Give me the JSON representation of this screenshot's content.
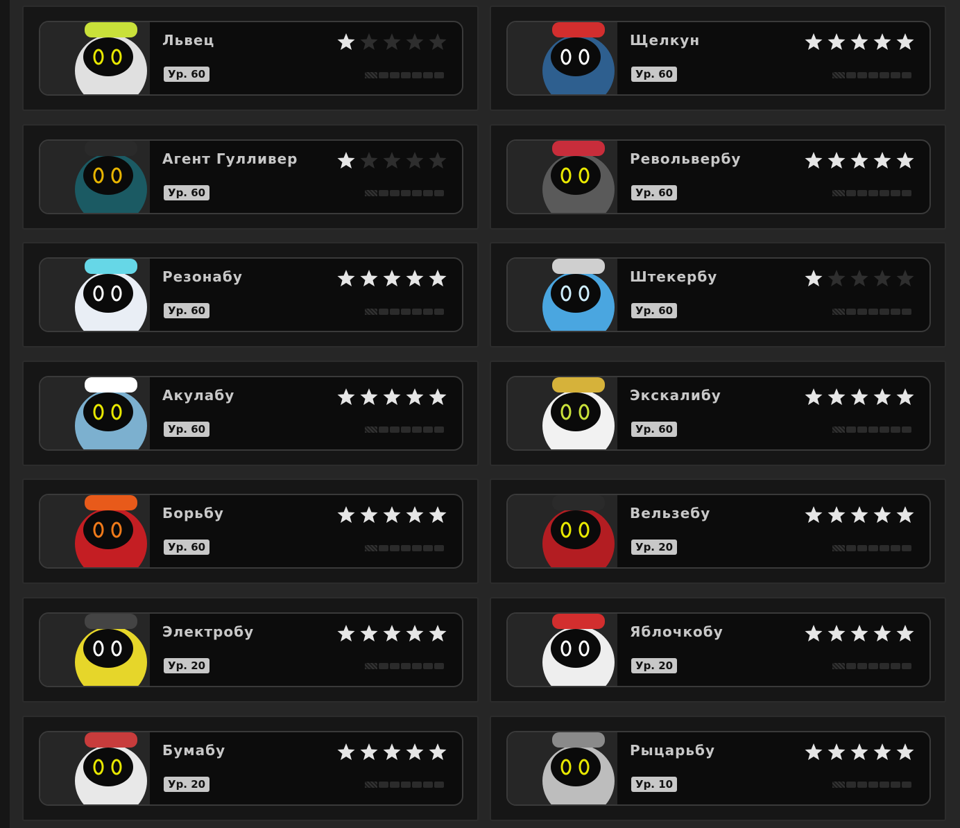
{
  "cards": [
    {
      "name": "Львец",
      "level": "Ур. 60",
      "stars": 1,
      "colors": {
        "body": "#e0e0e0",
        "accent": "#c9e13a",
        "eye": "#e8e800"
      }
    },
    {
      "name": "Щелкун",
      "level": "Ур. 60",
      "stars": 5,
      "colors": {
        "body": "#2e5f8f",
        "accent": "#d22e2e",
        "eye": "#ffffff"
      }
    },
    {
      "name": "Агент Гулливер",
      "level": "Ур. 60",
      "stars": 1,
      "colors": {
        "body": "#1b5a63",
        "accent": "#2a2a2a",
        "eye": "#e8b500"
      }
    },
    {
      "name": "Револьвербу",
      "level": "Ур. 60",
      "stars": 5,
      "colors": {
        "body": "#5a5a5a",
        "accent": "#c82d3b",
        "eye": "#e8e800"
      }
    },
    {
      "name": "Резонабу",
      "level": "Ур. 60",
      "stars": 5,
      "colors": {
        "body": "#e9eef5",
        "accent": "#66d7e7",
        "eye": "#ffffff"
      }
    },
    {
      "name": "Штекербу",
      "level": "Ур. 60",
      "stars": 1,
      "colors": {
        "body": "#4aa6e0",
        "accent": "#cfcfcf",
        "eye": "#cfeefd"
      }
    },
    {
      "name": "Акулабу",
      "level": "Ур. 60",
      "stars": 5,
      "colors": {
        "body": "#7cb0cf",
        "accent": "#ffffff",
        "eye": "#e8e800"
      }
    },
    {
      "name": "Экскалибу",
      "level": "Ур. 60",
      "stars": 5,
      "colors": {
        "body": "#f2f2f2",
        "accent": "#d6b23a",
        "eye": "#c9e13a"
      }
    },
    {
      "name": "Борьбу",
      "level": "Ур. 60",
      "stars": 5,
      "colors": {
        "body": "#c41e23",
        "accent": "#e85a1a",
        "eye": "#f07a1a"
      }
    },
    {
      "name": "Вельзебу",
      "level": "Ур. 20",
      "stars": 5,
      "colors": {
        "body": "#b31d22",
        "accent": "#2a2a2a",
        "eye": "#e8e800"
      }
    },
    {
      "name": "Электробу",
      "level": "Ур. 20",
      "stars": 5,
      "colors": {
        "body": "#e6d62a",
        "accent": "#444444",
        "eye": "#ffffff"
      }
    },
    {
      "name": "Яблочкобу",
      "level": "Ур. 20",
      "stars": 5,
      "colors": {
        "body": "#eeeeee",
        "accent": "#d22e2e",
        "eye": "#ffffff"
      }
    },
    {
      "name": "Бумабу",
      "level": "Ур. 20",
      "stars": 5,
      "colors": {
        "body": "#e8e8e8",
        "accent": "#c83c3c",
        "eye": "#e8e800"
      }
    },
    {
      "name": "Рыцарьбу",
      "level": "Ур. 10",
      "stars": 5,
      "colors": {
        "body": "#bdbdbd",
        "accent": "#8a8a8a",
        "eye": "#e8e800"
      }
    }
  ]
}
